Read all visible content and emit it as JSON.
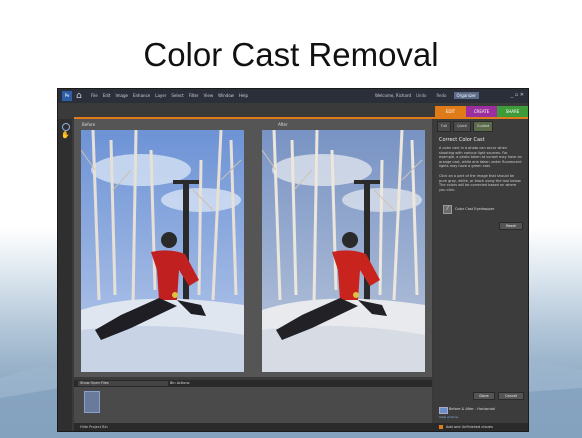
{
  "slide": {
    "title": "Color Cast Removal"
  },
  "app": {
    "logo": "Pe",
    "menu": [
      "File",
      "Edit",
      "Image",
      "Enhance",
      "Layer",
      "Select",
      "Filter",
      "View",
      "Window",
      "Help"
    ],
    "welcome": "Welcome, Richard",
    "header_buttons": [
      "Undo",
      "Redo",
      "Organizer"
    ],
    "window_controls": "_ ▫ ✕",
    "tabs": {
      "edit": "EDIT",
      "create": "CREATE",
      "share": "SHARE"
    },
    "colors": {
      "edit": "#e07b19",
      "create": "#9b2fa0",
      "share": "#3f9c3a"
    }
  },
  "workspace": {
    "before_label": "Before",
    "after_label": "After"
  },
  "bin": {
    "show_open": "Show Open Files",
    "bin_actions": "Bin Actions",
    "hide": "Hide Project Bin"
  },
  "panel": {
    "modes": [
      "Full",
      "Quick",
      "Guided"
    ],
    "title": "Correct Color Cast",
    "p1": "A color cast in a photo can occur when shooting with various light sources. For example, a photo taken at sunset may have an orange cast, while one taken under fluorescent lights may have a green cast.",
    "p2": "Click on a part of the image that should be pure gray, white, or black using the tool below. The colors will be corrected based on where you click.",
    "eyedropper_label": "Color Cast Eyedropper",
    "reset": "Reset",
    "done": "Done",
    "cancel": "Cancel",
    "view": "Before & After - Horizontal",
    "view_sub": "View Actions",
    "status": "Add and Unfinished chores"
  }
}
